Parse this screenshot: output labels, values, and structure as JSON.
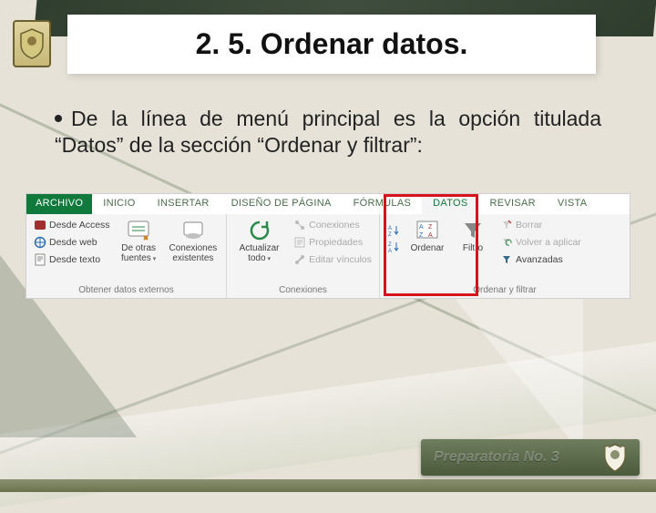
{
  "title": "2. 5. Ordenar datos.",
  "bullet_text": "De la línea de menú principal es la opción titulada “Datos” de la sección “Ordenar y filtrar”:",
  "ribbon": {
    "tabs": {
      "file": "ARCHIVO",
      "inicio": "INICIO",
      "insertar": "INSERTAR",
      "diseno": "DISEÑO DE PÁGINA",
      "formulas": "FÓRMULAS",
      "datos": "DATOS",
      "revisar": "REVISAR",
      "vista": "VISTA"
    },
    "group_get_external": {
      "access": "Desde Access",
      "web": "Desde web",
      "text": "Desde texto",
      "other": "De otras fuentes",
      "existing": "Conexiones existentes",
      "label": "Obtener datos externos"
    },
    "group_connections": {
      "refresh": "Actualizar todo",
      "connections": "Conexiones",
      "properties": "Propiedades",
      "edit_links": "Editar vínculos",
      "label": "Conexiones"
    },
    "group_sort_filter": {
      "az": "A↓Z",
      "za": "Z↓A",
      "sort": "Ordenar",
      "filter": "Filtro",
      "clear": "Borrar",
      "reapply": "Volver a aplicar",
      "advanced": "Avanzadas",
      "label": "Ordenar y filtrar"
    }
  },
  "footer": {
    "text": "Preparatoria No. 3"
  }
}
